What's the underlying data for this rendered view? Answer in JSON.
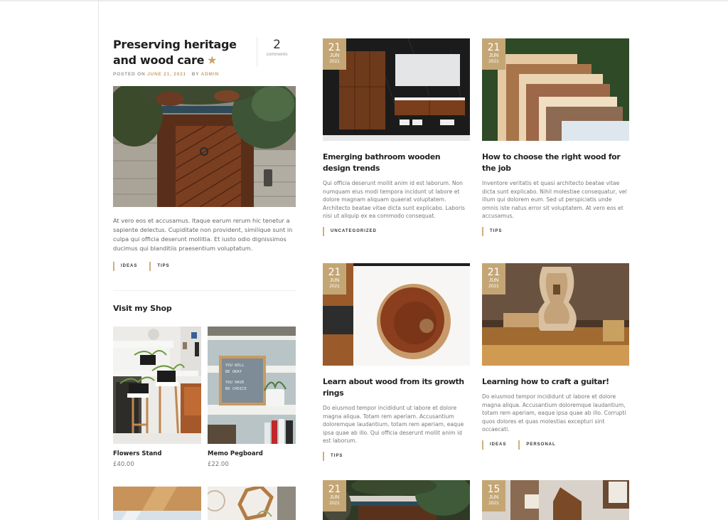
{
  "featured_post": {
    "title": "Preserving heritage and wood care",
    "title_line1": "Preserving heritage and",
    "title_line2": "wood care",
    "star_icon": "star-icon",
    "comments_count": "2",
    "comments_label": "comments",
    "meta_posted_on": "POSTED ON",
    "meta_date": "JUNE 21, 2021",
    "meta_by": "BY",
    "meta_author": "ADMIN",
    "image": "wooden door with ivy",
    "excerpt": "At vero eos et accusamus. Itaque earum rerum hic tenetur a sapiente delectus. Cupiditate non provident, similique sunt in culpa qui officia deserunt mollitia. Et iusto odio dignissimos ducimus qui blanditiis praesentium voluptatum.",
    "tags": [
      "IDEAS",
      "TIPS"
    ]
  },
  "shop": {
    "title": "Visit my Shop",
    "products": [
      {
        "name": "Flowers Stand",
        "price": "£40.00",
        "image": "plant stand"
      },
      {
        "name": "Memo Pegboard",
        "price": "£22.00",
        "image": "letter board",
        "board_text": "YOU WILL BE OKAY  YOU HAVE NO CHOICE"
      },
      {
        "name": "",
        "price": "",
        "image": "wood shelf"
      },
      {
        "name": "",
        "price": "",
        "image": "hexagon shelf"
      }
    ]
  },
  "posts": [
    {
      "day": "21",
      "month": "JUN",
      "year": "2021",
      "title": "Emerging bathroom wooden design trends",
      "excerpt": "Qui officia deserunt mollit anim id est laborum. Non numquam eius modi tempora incidunt ut labore et dolore magnam aliquam quaerat voluptatem. Architecto beatae vitae dicta sunt explicabo. Laboris nisi ut aliquip ex ea commodo consequat.",
      "tags": [
        "UNCATEGORIZED"
      ],
      "image": "bathroom vanity"
    },
    {
      "day": "21",
      "month": "JUN",
      "year": "2021",
      "title": "How to choose the right wood for the job",
      "excerpt": "Inventore veritatis et quasi architecto beatae vitae dicta sunt explicabo. Nihil molestiae consequatur, vel illum qui dolorem eum. Sed ut perspiciatis unde omnis iste natus error sit voluptatem. At vero eos et accusamus.",
      "tags": [
        "TIPS"
      ],
      "image": "wood samples"
    },
    {
      "day": "21",
      "month": "JUN",
      "year": "2021",
      "title": "Learn about wood from its growth rings",
      "excerpt": "Do eiusmod tempor incididunt ut labore et dolore magna aliqua. Totam rem aperiam. Accusantium doloremque laudantium, totam rem aperiam, eaque ipsa quae ab illo. Qui officia deserunt mollit anim id est laborum.",
      "tags": [
        "TIPS"
      ],
      "image": "tree slice"
    },
    {
      "day": "21",
      "month": "JUN",
      "year": "2021",
      "title": "Learning how to craft a guitar!",
      "excerpt": "Do eiusmod tempor incididunt ut labore et dolore magna aliqua. Accusantium doloremque laudantium, totam rem aperiam, eaque ipsa quae ab illo. Corrupti quos dolores et quas molestias excepturi sint occaecati.",
      "tags": [
        "IDEAS",
        "PERSONAL"
      ],
      "image": "guitar workshop"
    },
    {
      "day": "21",
      "month": "JUN",
      "year": "2021",
      "image": "ivy door"
    },
    {
      "day": "15",
      "month": "JUN",
      "year": "2021",
      "image": "wood workshop"
    }
  ],
  "colors": {
    "accent": "#c8a46e",
    "badge": "#c4a675"
  }
}
